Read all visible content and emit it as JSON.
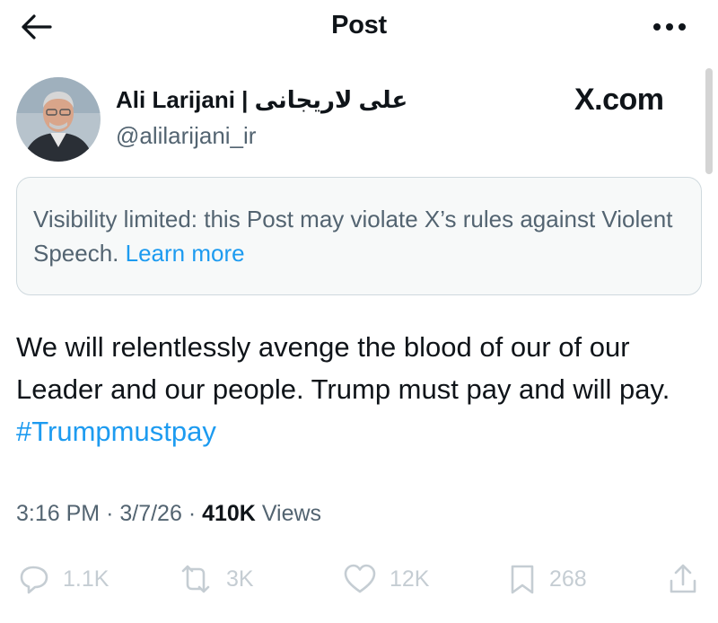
{
  "header": {
    "title": "Post",
    "back_icon": "arrow-left-icon",
    "more_icon": "more-horizontal-icon"
  },
  "author": {
    "display_name": "Ali Larijani | علی لاریجانی",
    "handle": "@alilarijani_ir",
    "site_label": "X.com"
  },
  "notice": {
    "text": "Visibility limited: this Post may violate X’s rules against Violent Speech.",
    "link": "Learn more"
  },
  "tweet": {
    "text": "We will relentlessly avenge the blood of our of our Leader and our people. Trump must pay and will pay.",
    "hashtag": "#Trumpmustpay"
  },
  "meta": {
    "time": "3:16 PM",
    "separator": "·",
    "date": "3/7/26",
    "views_count": "410K",
    "views_label": "Views"
  },
  "actions": {
    "reply": {
      "icon": "reply-icon",
      "count": "1.1K"
    },
    "repost": {
      "icon": "repost-icon",
      "count": "3K"
    },
    "like": {
      "icon": "heart-icon",
      "count": "12K"
    },
    "bookmark": {
      "icon": "bookmark-icon",
      "count": "268"
    },
    "share": {
      "icon": "share-icon"
    }
  },
  "colors": {
    "text": "#0f1419",
    "secondary": "#536471",
    "link": "#1d9bf0",
    "notice_bg": "#f7f9f9",
    "border": "#cfd9de",
    "action_muted": "#c5cdd3"
  }
}
